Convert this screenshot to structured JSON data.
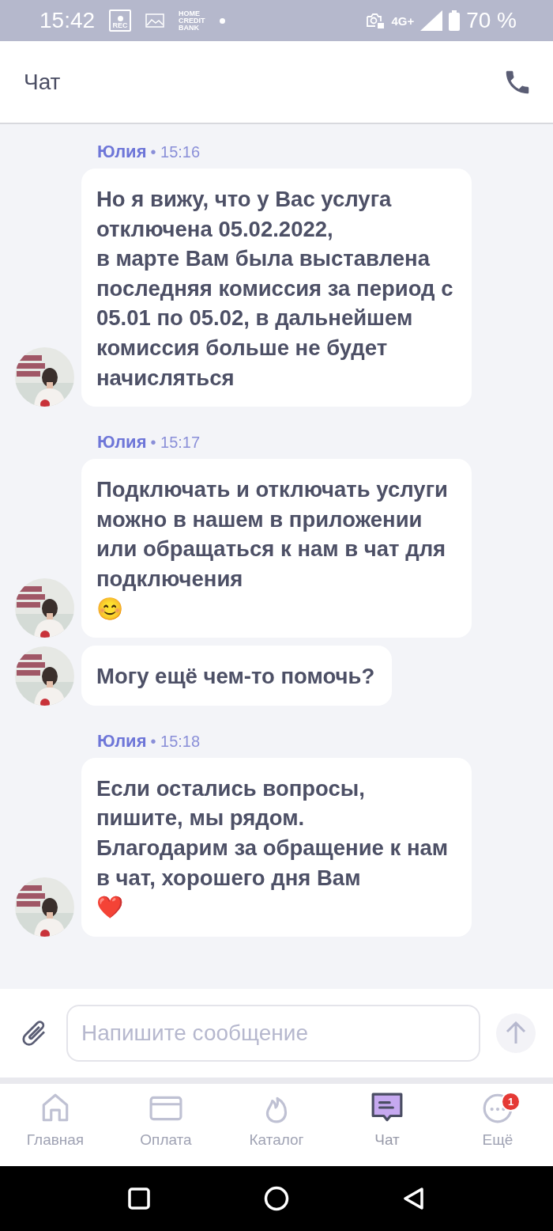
{
  "status_bar": {
    "time": "15:42",
    "rec_label": "REC",
    "logo_lines": [
      "HOME",
      "CREDIT",
      "BANK"
    ],
    "network": "4G+",
    "battery": "70 %"
  },
  "header": {
    "title": "Чат"
  },
  "messages": [
    {
      "sender": "Юлия",
      "time": "• 15:16",
      "text": "Но я вижу, что у Вас услуга отключена 05.02.2022,\nв марте Вам была выставлена последняя комиссия за период с 05.01 по 05.02, в дальнейшем комиссия больше не будет начисляться"
    },
    {
      "sender": "Юлия",
      "time": "• 15:17",
      "text": "Подключать и отключать услуги можно в нашем в приложении или обращаться к нам в чат для подключения\n😊"
    },
    {
      "text": "Могу ещё чем-то помочь?"
    },
    {
      "sender": "Юлия",
      "time": "• 15:18",
      "text": "Если остались вопросы, пишите, мы рядом.\nБлагодарим за обращение к нам в чат, хорошего дня Вам\n❤️"
    }
  ],
  "composer": {
    "placeholder": "Напишите сообщение"
  },
  "nav": [
    {
      "kind": "home",
      "label": "Главная",
      "selected": false
    },
    {
      "kind": "card",
      "label": "Оплата",
      "selected": false
    },
    {
      "kind": "flame",
      "label": "Каталог",
      "selected": false
    },
    {
      "kind": "chat",
      "label": "Чат",
      "selected": true
    },
    {
      "kind": "more",
      "label": "Ещё",
      "selected": false,
      "badge": "1"
    }
  ]
}
